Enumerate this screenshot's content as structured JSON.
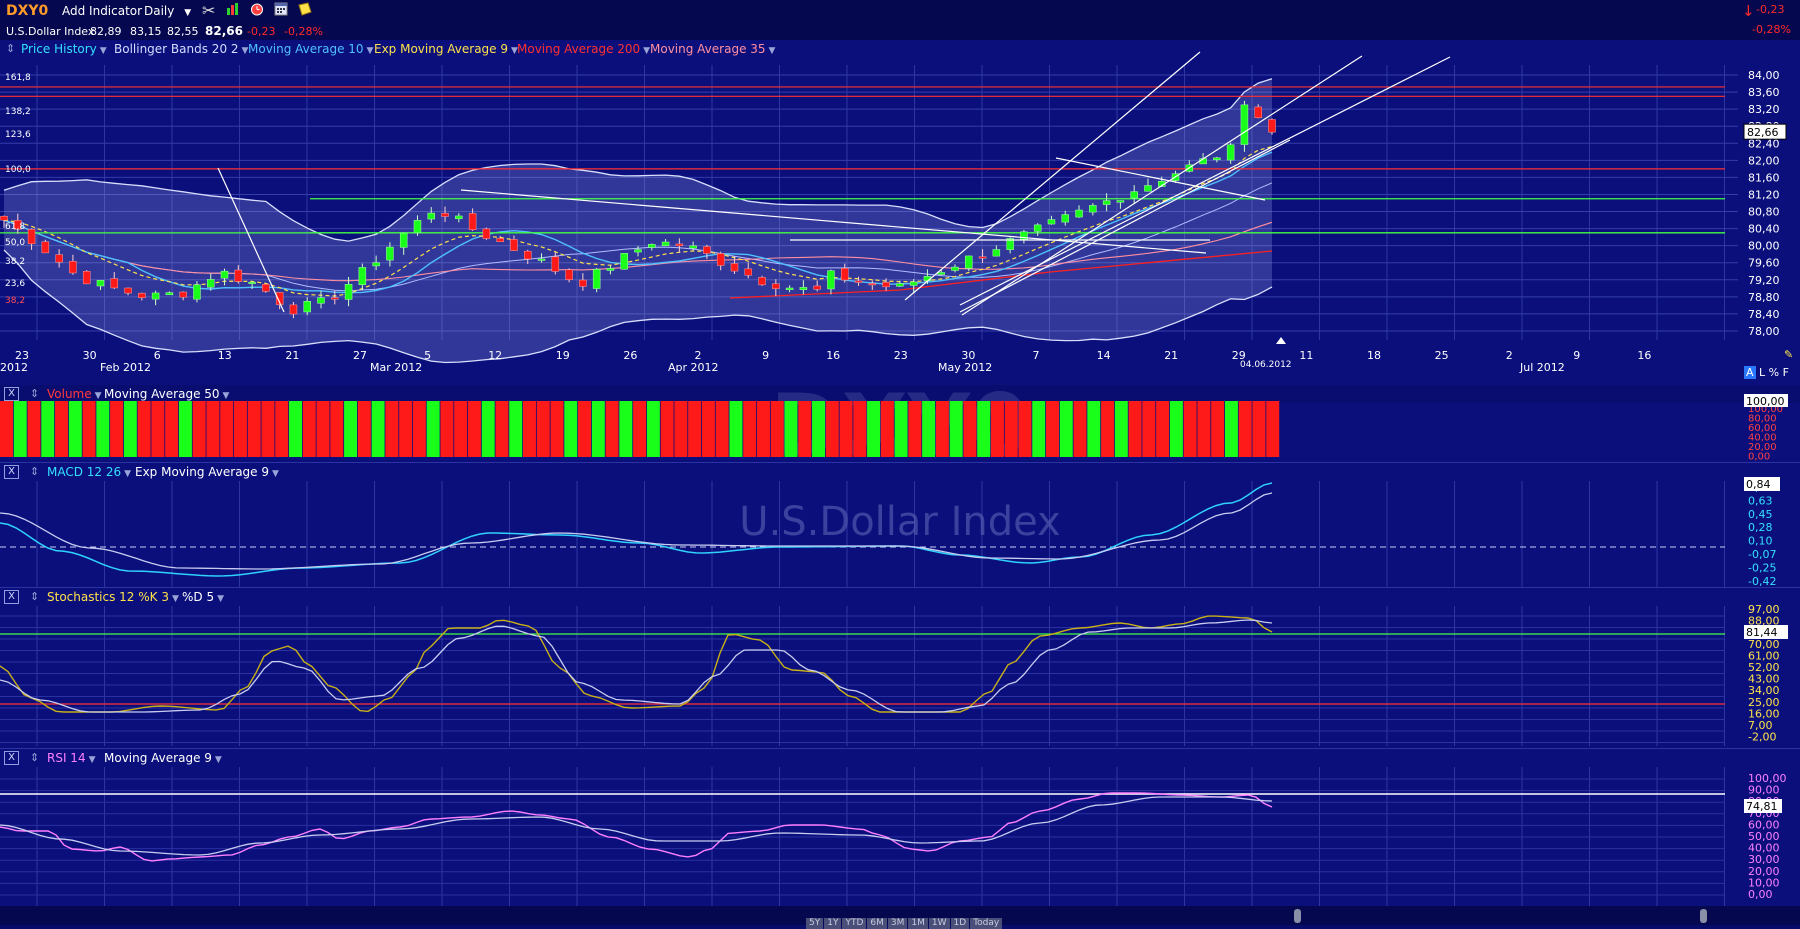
{
  "toolbar": {
    "symbol": "DXY0",
    "add_indicator": "Add Indicator",
    "interval": "Daily",
    "change_abs": "-0,23",
    "change_pct": "-0,28%"
  },
  "quote": {
    "name": "U.S.Dollar Index",
    "open": "82,89",
    "high": "83,15",
    "low": "82,55",
    "last": "82,66",
    "chg": "-0,23",
    "chg_pct": "-0,28%"
  },
  "indicators": [
    {
      "label": "Price History",
      "color": "#34e0ff"
    },
    {
      "label": "Bollinger Bands 20 2",
      "color": "#d4dcff"
    },
    {
      "label": "Moving Average 10",
      "color": "#4fc0ff"
    },
    {
      "label": "Exp Moving Average 9",
      "color": "#ffe24a"
    },
    {
      "label": "Moving Average 200",
      "color": "#ff3030"
    },
    {
      "label": "Moving Average 35",
      "color": "#ff8fa0"
    }
  ],
  "fib_labels": [
    "161,8",
    "138,2",
    "123,6",
    "100,0",
    "61,8",
    "50,0",
    "38,2",
    "23,6",
    "38,2"
  ],
  "price_axis": [
    "84,00",
    "83,60",
    "83,20",
    "82,80",
    "82,40",
    "82,00",
    "81,60",
    "81,20",
    "80,80",
    "80,40",
    "80,00",
    "79,60",
    "79,20",
    "78,80",
    "78,40",
    "78,00"
  ],
  "price_last": "82,66",
  "date_ticks": [
    "23",
    "30",
    "6",
    "13",
    "21",
    "27",
    "5",
    "12",
    "19",
    "26",
    "2",
    "9",
    "16",
    "23",
    "30",
    "7",
    "14",
    "21",
    "29",
    "11",
    "18",
    "25",
    "2",
    "9",
    "16"
  ],
  "month_ticks": [
    "2012",
    "Feb 2012",
    "Mar 2012",
    "Apr 2012",
    "May 2012",
    "Jul 2012"
  ],
  "cursor_date": "04.06.2012",
  "scale_buttons": [
    "A",
    "L",
    "%",
    "F"
  ],
  "volume": {
    "title": "Volume",
    "ma": "Moving Average 50",
    "axis": [
      "100,00",
      "80,00",
      "60,00",
      "40,00",
      "20,00",
      "0,00"
    ],
    "last": "100,00",
    "watermark": "DXY0"
  },
  "macd": {
    "title": "MACD 12 26",
    "ema": "Exp Moving Average 9",
    "axis": [
      "0,84",
      "0,63",
      "0,45",
      "0,28",
      "0,10",
      "-0,07",
      "-0,25",
      "-0,42"
    ],
    "last": "0,84",
    "watermark": "U.S.Dollar Index"
  },
  "stoch": {
    "title": "Stochastics 12 %K 3",
    "d": "%D 5",
    "axis": [
      "97,00",
      "88,00",
      "79,00",
      "70,00",
      "61,00",
      "52,00",
      "43,00",
      "34,00",
      "25,00",
      "16,00",
      "7,00",
      "-2,00"
    ],
    "last": "81,44"
  },
  "rsi": {
    "title": "RSI 14",
    "ma": "Moving Average 9",
    "axis": [
      "100,00",
      "90,00",
      "80,00",
      "70,00",
      "60,00",
      "50,00",
      "40,00",
      "30,00",
      "20,00",
      "10,00",
      "0,00"
    ],
    "last": "74,81"
  },
  "ranges": [
    "5Y",
    "1Y",
    "YTD",
    "6M",
    "3M",
    "1M",
    "1W",
    "1D",
    "Today"
  ],
  "colors": {
    "bg": "#0a0f7c",
    "up": "#1aff1a",
    "down": "#ff1a1a",
    "grid": "#3a41a8"
  }
}
